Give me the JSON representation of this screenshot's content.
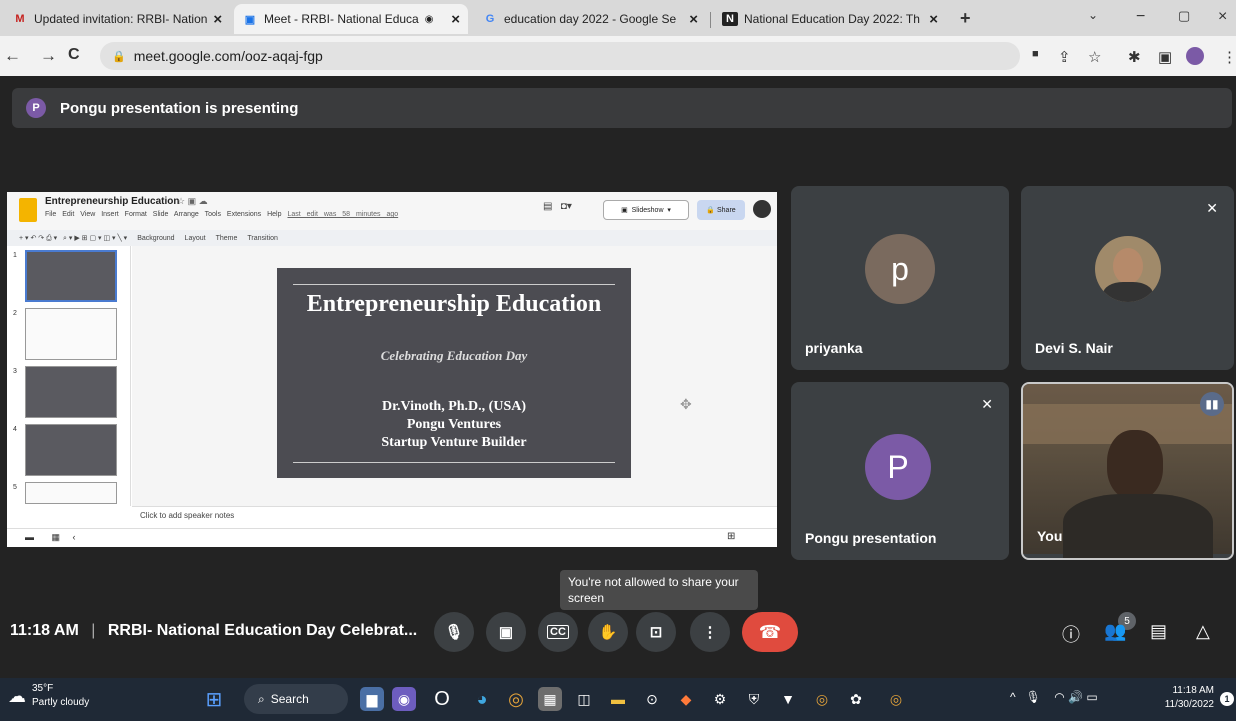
{
  "browser": {
    "tabs": [
      {
        "title": "Updated invitation: RRBI- Nation",
        "icon": "M"
      },
      {
        "title": "Meet - RRBI- National Educa",
        "icon": "▣"
      },
      {
        "title": "education day 2022 - Google Se",
        "icon": "G"
      },
      {
        "title": "National Education Day 2022: Th",
        "icon": "N"
      }
    ],
    "new_tab": "+",
    "url": "meet.google.com/ooz-aqaj-fgp"
  },
  "meet": {
    "presenting_avatar": "P",
    "presenting_text": "Pongu presentation is presenting",
    "time": "11:18 AM",
    "meeting_title": "RRBI- National Education Day Celebrat...",
    "tooltip": "You're not allowed to share your screen",
    "people_count": "5",
    "participants": [
      {
        "name": "priyanka",
        "initial": "p",
        "color": "#7a6a5e"
      },
      {
        "name": "Devi S. Nair",
        "initial": "",
        "color": "#a08a6a"
      },
      {
        "name": "Pongu presentation",
        "initial": "P",
        "color": "#7b5aa6"
      },
      {
        "name": "You",
        "initial": "",
        "color": ""
      }
    ]
  },
  "slides": {
    "doc_title": "Entrepreneurship Education",
    "menu": "File Edit View Insert Format Slide Arrange Tools Extensions Help",
    "last_edit": "Last edit was 58 minutes ago",
    "slideshow_label": "Slideshow",
    "share_label": "Share",
    "toolbar": [
      "Background",
      "Layout",
      "Theme",
      "Transition"
    ],
    "thumb_numbers": [
      "1",
      "2",
      "3",
      "4",
      "5"
    ],
    "slide_title": "Entrepreneurship Education",
    "slide_subtitle": "Celebrating Education Day",
    "slide_author_lines": [
      "Dr.Vinoth, Ph.D., (USA)",
      "Pongu Ventures",
      "Startup Venture Builder"
    ],
    "notes_placeholder": "Click to add speaker notes"
  },
  "taskbar": {
    "weather_temp": "35°F",
    "weather_text": "Partly cloudy",
    "search_label": "Search",
    "clock_time": "11:18 AM",
    "clock_date": "11/30/2022",
    "notif_count": "1"
  }
}
